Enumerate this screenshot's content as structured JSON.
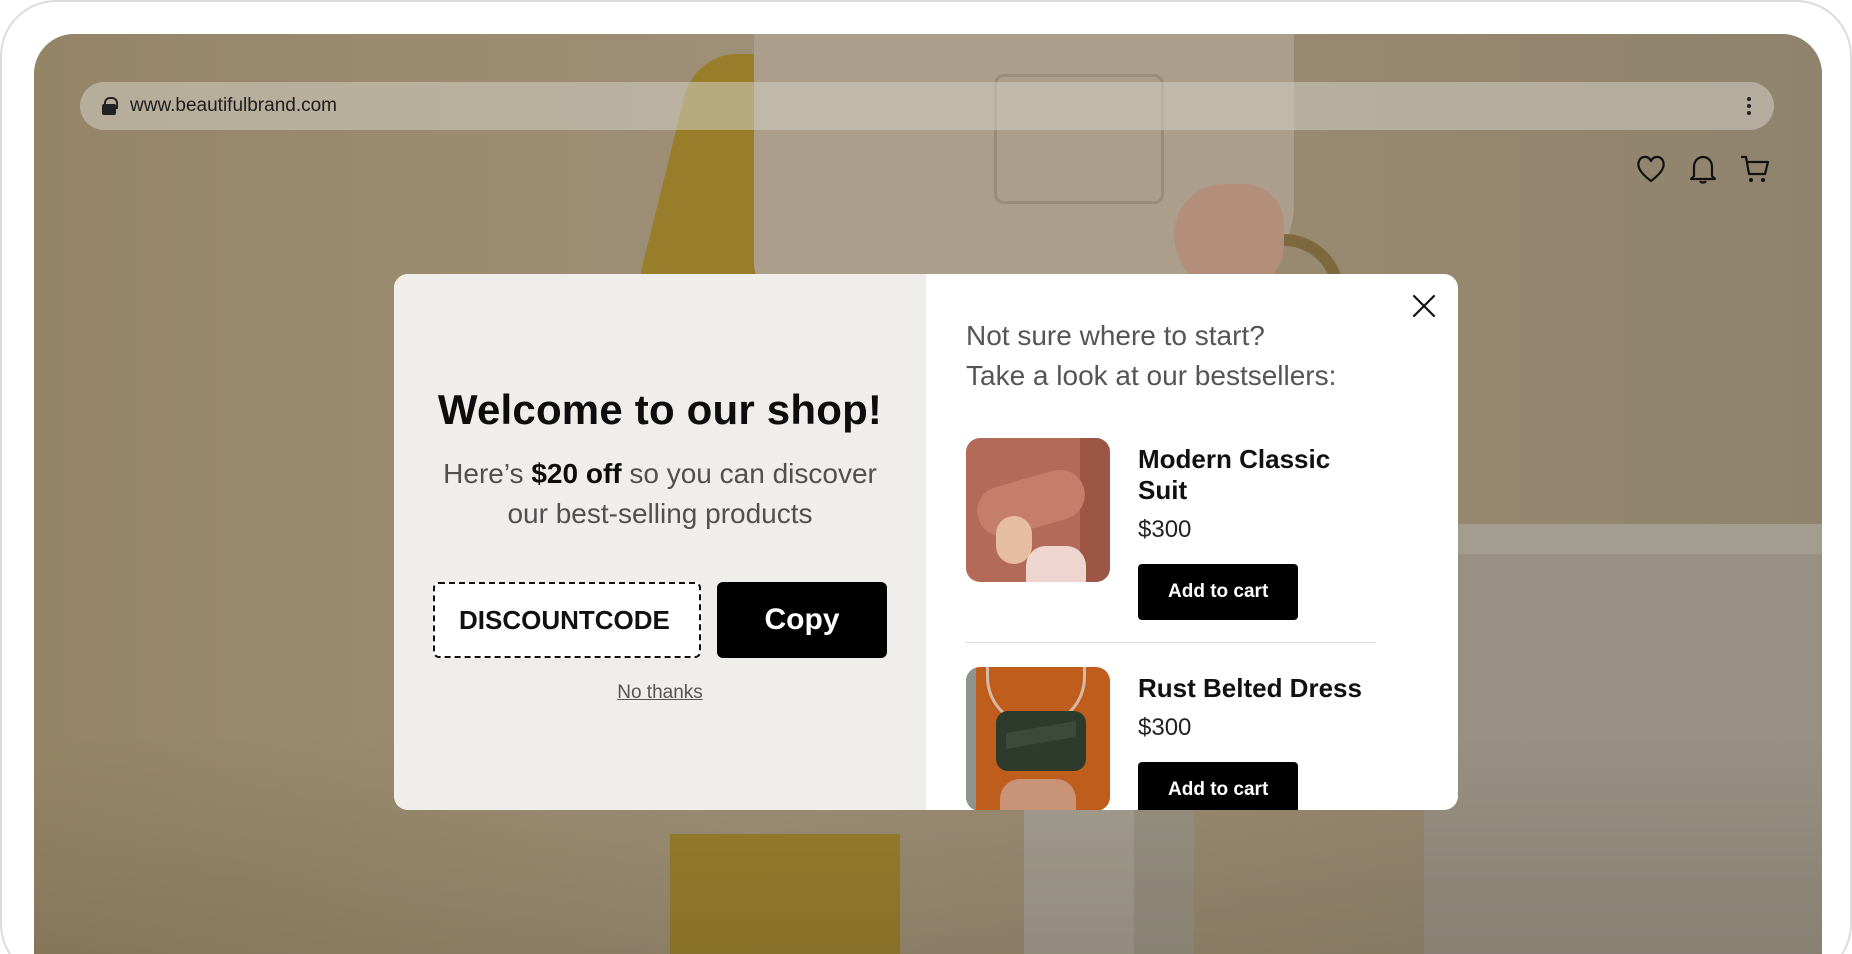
{
  "browser": {
    "url": "www.beautifulbrand.com"
  },
  "header": {
    "icons": [
      "heart-icon",
      "bell-icon",
      "cart-icon"
    ]
  },
  "modal": {
    "title": "Welcome to our shop!",
    "offer_prefix": "Here’s ",
    "offer_highlight": "$20 off",
    "offer_suffix": " so you can discover our best-selling products",
    "discount_code": "DISCOUNTCODE",
    "copy_label": "Copy",
    "decline_label": "No thanks",
    "bestsellers_intro_line1": "Not sure where to start?",
    "bestsellers_intro_line2": "Take a look at our bestsellers:",
    "products": [
      {
        "name": "Modern Classic Suit",
        "price": "$300",
        "cta": "Add to cart"
      },
      {
        "name": "Rust Belted Dress",
        "price": "$300",
        "cta": "Add to cart"
      }
    ]
  },
  "colors": {
    "modal_left_bg": "#f0eeeb",
    "button_bg": "#000000",
    "button_text": "#ffffff"
  }
}
